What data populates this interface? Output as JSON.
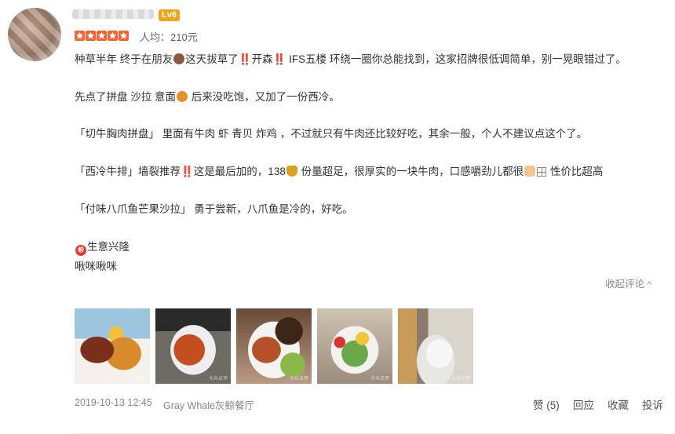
{
  "user": {
    "level": "Lv6",
    "rating_stars": 5
  },
  "review": {
    "avg_price": "人均：210元",
    "lines": [
      {
        "a": "种草半年 终于在朋友",
        "emoji": "cake-emoji",
        "b": "这天拔草了‼️开森‼️ IFS五楼 环绕一圈你总能找到，这家招牌很低调简单，别一晃眼错过了。"
      },
      {
        "a": "先点了拼盘 沙拉 意面",
        "emoji": "pasta-emoji",
        "b": " 后来没吃饱，又加了一份西冷。"
      },
      {
        "a": "「切牛胸肉拼盘」 里面有牛肉 虾 青贝 炸鸡 ，不过就只有牛肉还比较好吃，其余一般，个人不建议点这个了。"
      },
      {
        "a": "「西冷牛排」墙裂推荐‼️这是最后加的，138",
        "emoji": "money-bag-emoji",
        "b": " 份量超足，很厚实的一块牛肉，口感嚼劲儿都很",
        "emoji2": "thumbs-up-emoji",
        "emoji3": "grid-emoji",
        "c": " 性价比超高"
      },
      {
        "a": "「付味八爪鱼芒果沙拉」 勇于尝新，八爪鱼是冷的，好吃。"
      },
      {
        "a": "生意兴隆",
        "emoji_before": "fortune-emoji",
        "emoji_glyph": "㊗"
      },
      {
        "a": "啾咪啾咪"
      }
    ],
    "collapse_label": "收起评论",
    "photo_watermark": "大众点评",
    "date": "2019-10-13 12:45",
    "shop": "Gray Whale灰鲸餐厅",
    "actions": {
      "like": "赞 (5)",
      "reply": "回应",
      "favorite": "收藏",
      "report": "投诉"
    }
  },
  "colors": {
    "level_badge": "#f0a417",
    "star": "#f6622b",
    "muted_text": "#888888"
  }
}
